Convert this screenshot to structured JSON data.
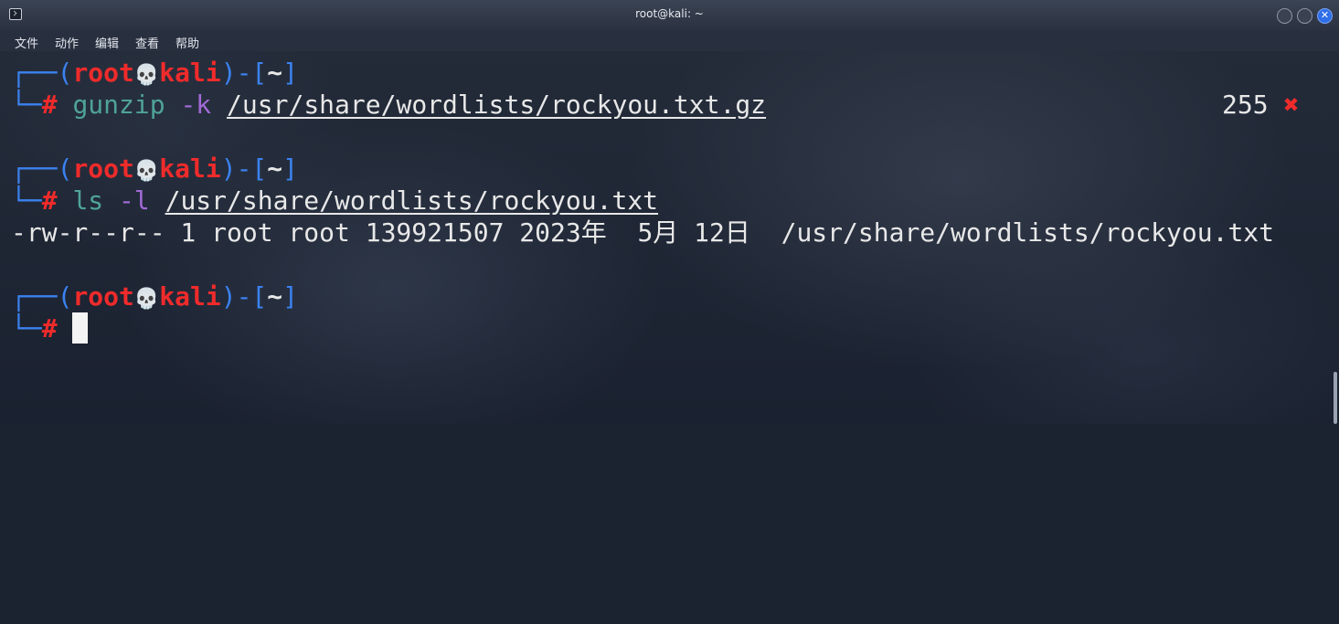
{
  "window": {
    "title": "root@kali: ~",
    "close_glyph": "✕"
  },
  "menubar": {
    "items": [
      "文件",
      "动作",
      "编辑",
      "查看",
      "帮助"
    ]
  },
  "prompt": {
    "open": "┌──(",
    "user": "root",
    "skull": "💀",
    "host": "kali",
    "mid": ")-[",
    "dir": "~",
    "close": "]",
    "lead": "└─",
    "hash": "#"
  },
  "entries": [
    {
      "command": "gunzip",
      "flag": "-k",
      "path": "/usr/share/wordlists/rockyou.txt.gz",
      "exit_code": "255",
      "exit_glyph": "✖"
    },
    {
      "command": "ls",
      "flag": "-l",
      "path": "/usr/share/wordlists/rockyou.txt",
      "output": "-rw-r--r-- 1 root root 139921507 2023年  5月 12日  /usr/share/wordlists/rockyou.txt"
    }
  ],
  "colors": {
    "prompt_frame": "#3b82f0",
    "prompt_user_host": "#ef2b2b",
    "command": "#4fa39a",
    "flag": "#a16ad6",
    "close_button": "#2f6ee8"
  }
}
